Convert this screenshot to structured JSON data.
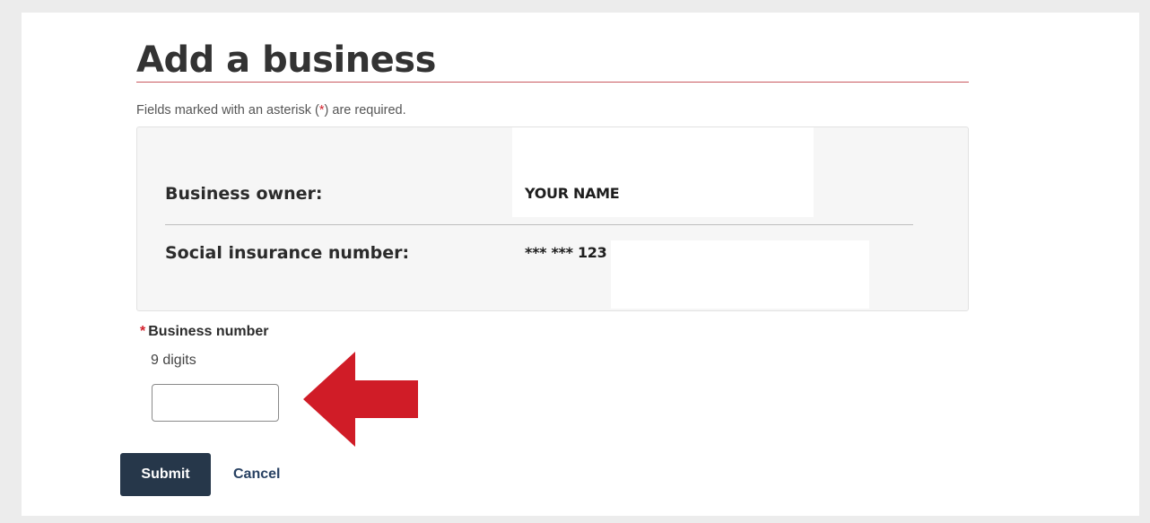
{
  "page": {
    "title": "Add a business",
    "required_note_prefix": "Fields marked with an asterisk (",
    "required_note_asterisk": "*",
    "required_note_suffix": ") are required."
  },
  "summary": {
    "owner_label": "Business owner:",
    "owner_value": "YOUR NAME",
    "sin_label": "Social insurance number:",
    "sin_value": "*** *** 123"
  },
  "business_number": {
    "required_marker": "*",
    "label": "Business number",
    "hint": "9 digits",
    "value": ""
  },
  "actions": {
    "submit_label": "Submit",
    "cancel_label": "Cancel"
  },
  "colors": {
    "required_red": "#d3212c",
    "arrow_red": "#d01c27",
    "submit_bg": "#26374a",
    "link": "#284162"
  }
}
